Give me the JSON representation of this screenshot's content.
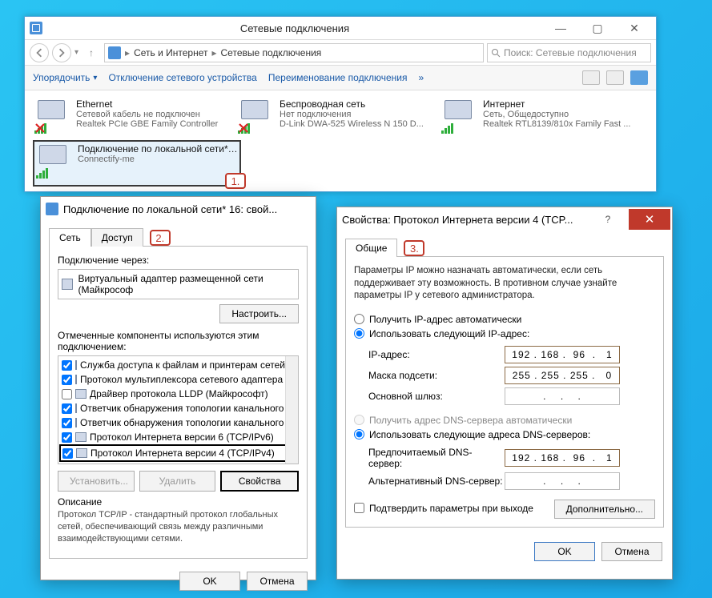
{
  "explorer": {
    "title": "Сетевые подключения",
    "breadcrumb": {
      "root": "Сеть и Интернет",
      "current": "Сетевые подключения"
    },
    "search_placeholder": "Поиск: Сетевые подключения",
    "toolbar": {
      "organize": "Упорядочить",
      "disable": "Отключение сетевого устройства",
      "rename": "Переименование подключения"
    },
    "connections": [
      {
        "name": "Ethernet",
        "status": "Сетевой кабель не подключен",
        "detail": "Realtek PCIe GBE Family Controller",
        "disabled": true
      },
      {
        "name": "Беспроводная сеть",
        "status": "Нет подключения",
        "detail": "D-Link DWA-525 Wireless N 150 D...",
        "disabled": true
      },
      {
        "name": "Интернет",
        "status": "Сеть, Общедоступно",
        "detail": "Realtek RTL8139/810x Family Fast ...",
        "disabled": false
      },
      {
        "name": "Подключение по локальной сети* 16",
        "status": "",
        "detail": "Connectify-me",
        "disabled": false,
        "selected": true
      }
    ]
  },
  "markers": {
    "m1": "1.",
    "m2": "2.",
    "m3": "3."
  },
  "dialog1": {
    "title": "Подключение по локальной сети* 16: свой...",
    "tabs": {
      "net": "Сеть",
      "access": "Доступ"
    },
    "connect_via_label": "Подключение через:",
    "adapter": "Виртуальный адаптер размещенной сети (Майкрософ",
    "configure_btn": "Настроить...",
    "components_label": "Отмеченные компоненты используются этим подключением:",
    "components": [
      {
        "checked": true,
        "label": "Служба доступа к файлам и принтерам сетей Micro"
      },
      {
        "checked": true,
        "label": "Протокол мультиплексора сетевого адаптера (Ма"
      },
      {
        "checked": false,
        "label": "Драйвер протокола LLDP (Майкрософт)"
      },
      {
        "checked": true,
        "label": "Ответчик обнаружения топологии канального уро"
      },
      {
        "checked": true,
        "label": "Ответчик обнаружения топологии канального уро"
      },
      {
        "checked": true,
        "label": "Протокол Интернета версии 6 (TCP/IPv6)"
      },
      {
        "checked": true,
        "label": "Протокол Интернета версии 4 (TCP/IPv4)",
        "highlighted": true
      }
    ],
    "install_btn": "Установить...",
    "remove_btn": "Удалить",
    "properties_btn": "Свойства",
    "description_title": "Описание",
    "description_body": "Протокол TCP/IP - стандартный протокол глобальных сетей, обеспечивающий связь между различными взаимодействующими сетями.",
    "ok_btn": "OK",
    "cancel_btn": "Отмена"
  },
  "dialog2": {
    "title": "Свойства: Протокол Интернета версии 4 (TCP...",
    "tab_general": "Общие",
    "info": "Параметры IP можно назначать автоматически, если сеть поддерживает эту возможность. В противном случае узнайте параметры IP у сетевого администратора.",
    "ip_auto": "Получить IP-адрес автоматически",
    "ip_manual": "Использовать следующий IP-адрес:",
    "ip_label": "IP-адрес:",
    "ip_value": "192 . 168 .  96  .   1",
    "mask_label": "Маска подсети:",
    "mask_value": "255 . 255 . 255 .   0",
    "gateway_label": "Основной шлюз:",
    "gateway_value": "   .    .    .   ",
    "dns_auto": "Получить адрес DNS-сервера автоматически",
    "dns_manual": "Использовать следующие адреса DNS-серверов:",
    "dns_pref_label": "Предпочитаемый DNS-сервер:",
    "dns_pref_value": "192 . 168 .  96  .   1",
    "dns_alt_label": "Альтернативный DNS-сервер:",
    "dns_alt_value": "   .    .    .   ",
    "confirm_exit": "Подтвердить параметры при выходе",
    "advanced_btn": "Дополнительно...",
    "ok_btn": "OK",
    "cancel_btn": "Отмена"
  }
}
